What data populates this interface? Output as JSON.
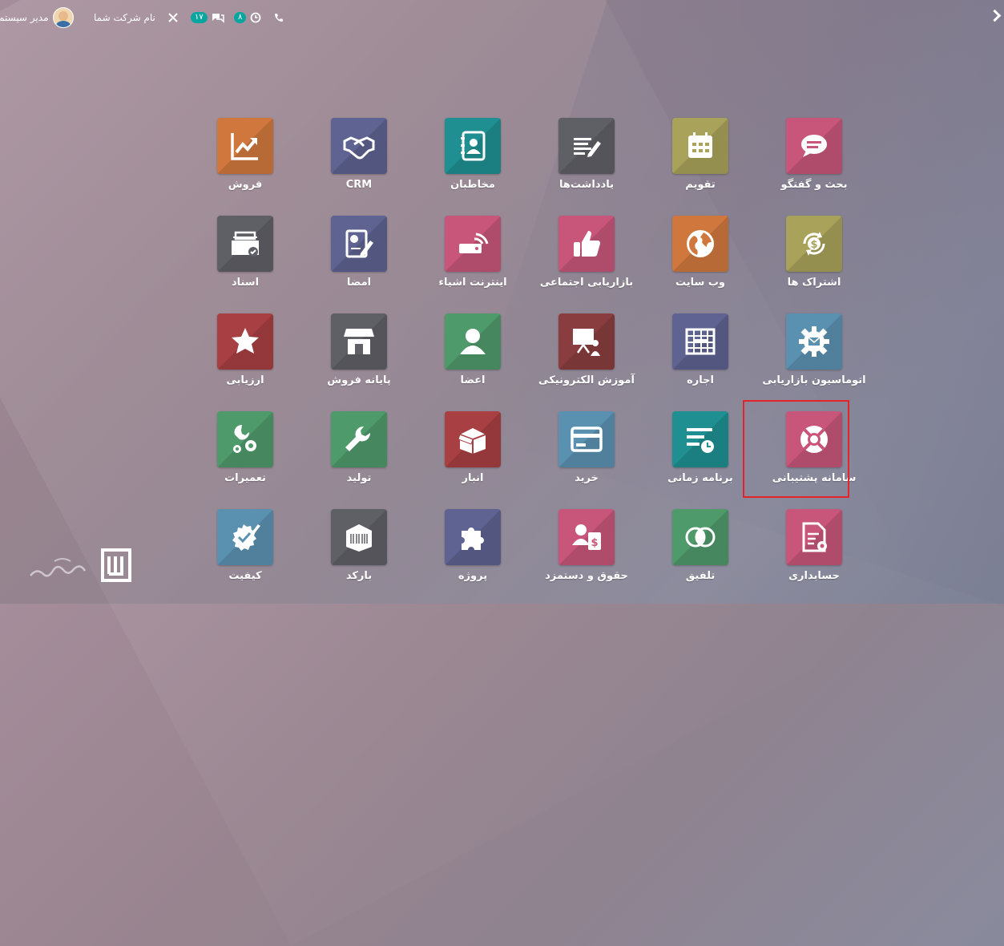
{
  "topbar": {
    "user_name": "مدیر سیستم",
    "company_name": "نام شرکت شما",
    "messages_count": "۱۷",
    "activities_count": "۸"
  },
  "apps": [
    {
      "label": "بحث و گفتگو",
      "icon": "chat-bubble-icon",
      "color": "#c8567a"
    },
    {
      "label": "تقویم",
      "icon": "calendar-icon",
      "color": "#a8a25a"
    },
    {
      "label": "یادداشت‌ها",
      "icon": "notes-pen-icon",
      "color": "#5f5f66"
    },
    {
      "label": "مخاطبان",
      "icon": "address-book-icon",
      "color": "#1f8f91"
    },
    {
      "label": "CRM",
      "icon": "handshake-icon",
      "color": "#5e6391"
    },
    {
      "label": "فروش",
      "icon": "chart-up-icon",
      "color": "#d0773e"
    },
    {
      "label": "اشتراک ها",
      "icon": "dollar-cycle-icon",
      "color": "#a8a25a"
    },
    {
      "label": "وب سایت",
      "icon": "globe-icon",
      "color": "#d0773e"
    },
    {
      "label": "بازاریابی اجتماعی",
      "icon": "thumbs-up-icon",
      "color": "#c8567a"
    },
    {
      "label": "اینترنت اشیاء",
      "icon": "iot-device-icon",
      "color": "#c8567a"
    },
    {
      "label": "امضا",
      "icon": "sign-document-icon",
      "color": "#5e6391"
    },
    {
      "label": "اسناد",
      "icon": "document-tray-icon",
      "color": "#5f5f66"
    },
    {
      "label": "اتوماسیون بازاریابی",
      "icon": "gear-mail-icon",
      "color": "#5b91b0"
    },
    {
      "label": "اجاره",
      "icon": "rental-grid-icon",
      "color": "#5e6391"
    },
    {
      "label": "آموزش الکترونیکی",
      "icon": "presentation-icon",
      "color": "#8a3d3e"
    },
    {
      "label": "اعضا",
      "icon": "user-icon",
      "color": "#4f9a6b"
    },
    {
      "label": "پایانه فروش",
      "icon": "store-icon",
      "color": "#5f5f66"
    },
    {
      "label": "ارزیابی",
      "icon": "star-icon",
      "color": "#a83f42"
    },
    {
      "label": "سامانه پشتیبانی",
      "icon": "lifebuoy-icon",
      "color": "#c8567a"
    },
    {
      "label": "برنامه زمانی",
      "icon": "planning-icon",
      "color": "#1f8f91"
    },
    {
      "label": "خرید",
      "icon": "credit-card-icon",
      "color": "#5b91b0"
    },
    {
      "label": "انبار",
      "icon": "box-icon",
      "color": "#a83f42"
    },
    {
      "label": "تولید",
      "icon": "wrench-icon",
      "color": "#4f9a6b"
    },
    {
      "label": "تعمیرات",
      "icon": "wrench-gears-icon",
      "color": "#4f9a6b"
    },
    {
      "label": "حسابداری",
      "icon": "invoice-icon",
      "color": "#c8567a"
    },
    {
      "label": "تلفیق",
      "icon": "circles-icon",
      "color": "#4f9a6b"
    },
    {
      "label": "حقوق و دستمزد",
      "icon": "payroll-icon",
      "color": "#c8567a"
    },
    {
      "label": "پروژه",
      "icon": "puzzle-icon",
      "color": "#5e6391"
    },
    {
      "label": "بارکد",
      "icon": "barcode-box-icon",
      "color": "#5f5f66"
    },
    {
      "label": "کیفیت",
      "icon": "quality-badge-icon",
      "color": "#5b91b0"
    }
  ]
}
